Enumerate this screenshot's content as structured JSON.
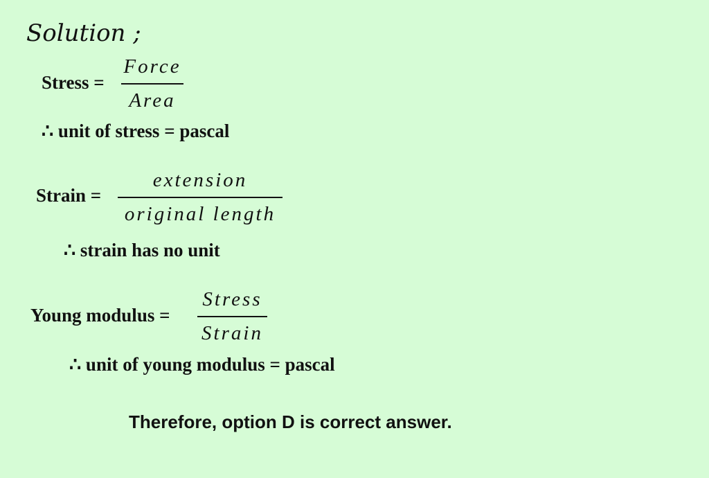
{
  "title": "Solution ;",
  "stress": {
    "lhs": "Stress =",
    "numerator": "Force",
    "denominator": "Area",
    "conclusion": "∴ unit of stress = pascal"
  },
  "strain": {
    "lhs": "Strain =",
    "numerator": "extension",
    "denominator": "original length",
    "conclusion": "∴ strain has no unit"
  },
  "young": {
    "lhs": "Young modulus =",
    "numerator": "Stress",
    "denominator": "Strain",
    "conclusion": "∴ unit of young modulus = pascal"
  },
  "final": "Therefore, option D is correct answer.",
  "colors": {
    "background": "#d6fcd6",
    "text": "#111111"
  }
}
